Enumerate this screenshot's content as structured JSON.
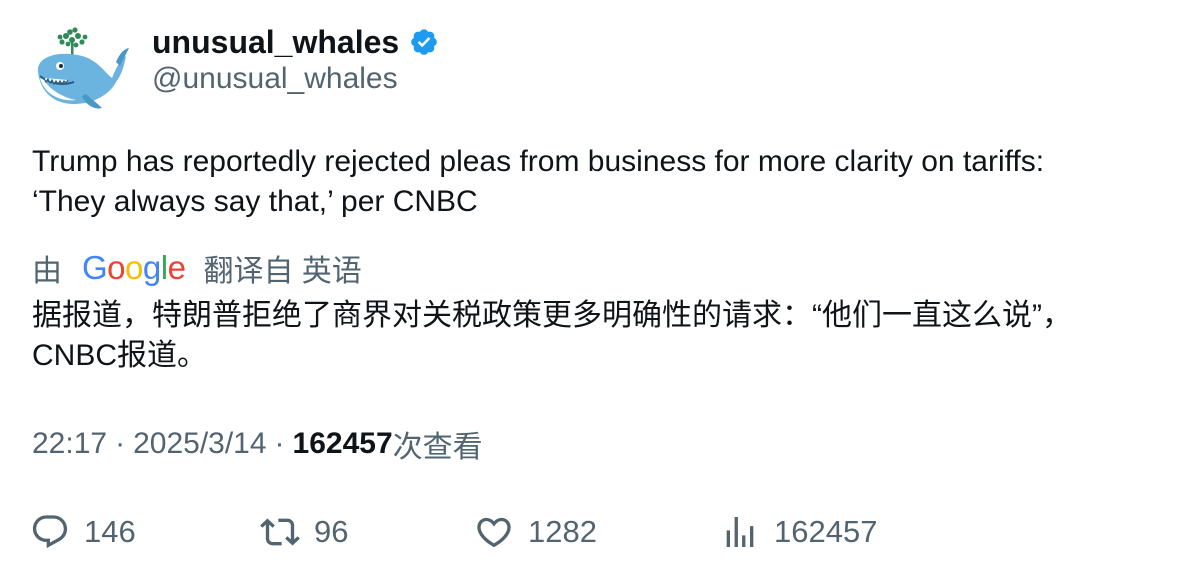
{
  "author": {
    "display_name": "unusual_whales",
    "handle": "@unusual_whales",
    "verified": true,
    "avatar_icon": "whale-avatar-icon"
  },
  "tweet": {
    "text_line1": "Trump has reportedly rejected pleas from business for more clarity on tariffs:",
    "text_line2": "‘They always say that,’ per CNBC"
  },
  "translation": {
    "prefix": "由",
    "provider": "Google",
    "suffix": "翻译自 英语",
    "text_line1": "据报道，特朗普拒绝了商界对关税政策更多明确性的请求：“他们一直这么说”，",
    "text_line2": "CNBC报道。"
  },
  "meta": {
    "time": "22:17",
    "separator": "·",
    "date": "2025/3/14",
    "views_count": "162457",
    "views_label": "次查看"
  },
  "actions": {
    "reply_count": "146",
    "retweet_count": "96",
    "like_count": "1282",
    "views_count": "162457"
  },
  "colors": {
    "text_primary": "#0f1419",
    "text_secondary": "#536471",
    "verified_blue": "#1d9bf0"
  }
}
